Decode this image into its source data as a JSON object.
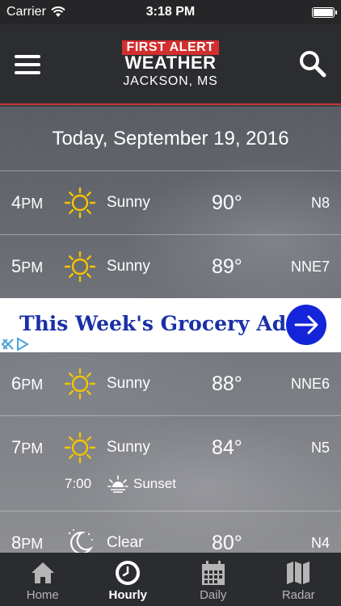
{
  "status_bar": {
    "carrier": "Carrier",
    "time": "3:18 PM"
  },
  "header": {
    "logo_top": "FIRST ALERT",
    "logo_bottom": "WEATHER",
    "city": "JACKSON, MS"
  },
  "date": "Today, September 19, 2016",
  "hours": [
    {
      "hour": "4",
      "ampm": "PM",
      "icon": "sun-icon",
      "condition": "Sunny",
      "temp": "90°",
      "wind": "N8"
    },
    {
      "hour": "5",
      "ampm": "PM",
      "icon": "sun-icon",
      "condition": "Sunny",
      "temp": "89°",
      "wind": "NNE7"
    },
    {
      "hour": "6",
      "ampm": "PM",
      "icon": "sun-icon",
      "condition": "Sunny",
      "temp": "88°",
      "wind": "NNE6"
    },
    {
      "hour": "7",
      "ampm": "PM",
      "icon": "sun-icon",
      "condition": "Sunny",
      "temp": "84°",
      "wind": "N5",
      "event": {
        "time": "7:00",
        "icon": "sunset-icon",
        "label": "Sunset"
      }
    },
    {
      "hour": "8",
      "ampm": "PM",
      "icon": "moon-icon",
      "condition": "Clear",
      "temp": "80°",
      "wind": "N4"
    }
  ],
  "ad": {
    "text": "This Week's Grocery Ad"
  },
  "tabs": [
    {
      "label": "Home",
      "icon": "home-icon"
    },
    {
      "label": "Hourly",
      "icon": "clock-icon",
      "active": true
    },
    {
      "label": "Daily",
      "icon": "calendar-icon"
    },
    {
      "label": "Radar",
      "icon": "map-icon"
    }
  ],
  "colors": {
    "accent_red": "#c8353c",
    "sun_yellow": "#f5c400",
    "ad_blue": "#1424d8"
  }
}
